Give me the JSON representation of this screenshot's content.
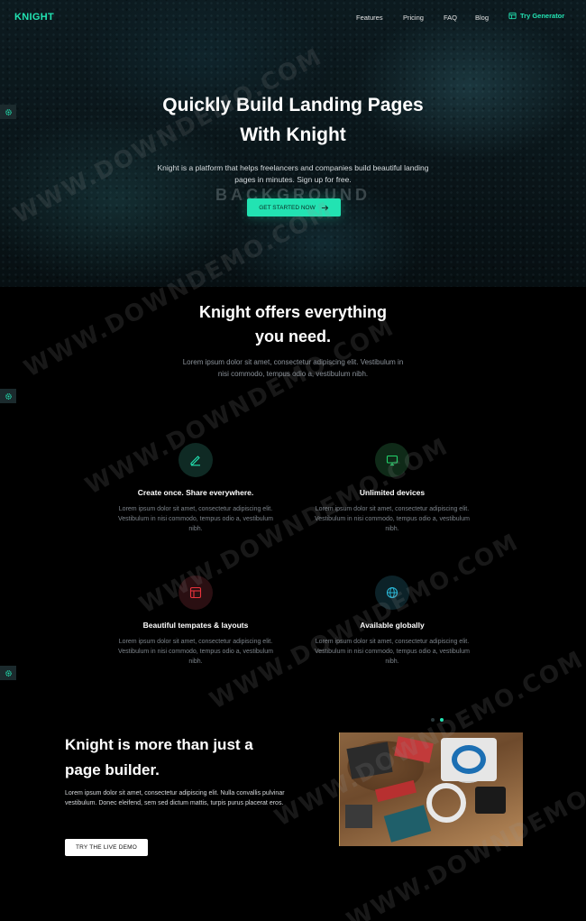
{
  "nav": {
    "logo": "KNIGHT",
    "links": [
      "Features",
      "Pricing",
      "FAQ",
      "Blog"
    ],
    "generator": "Try Generator"
  },
  "hero": {
    "title_line1": "Quickly Build Landing Pages",
    "title_line2": "With Knight",
    "subtitle": "Knight is a platform that helps freelancers and companies build beautiful landing pages in minutes. Sign up for free.",
    "bg_label": "BACKGROUND",
    "cta": "GET STARTED NOW"
  },
  "features_section": {
    "title_line1": "Knight offers everything",
    "title_line2": "you need.",
    "subtitle": "Lorem ipsum dolor sit amet, consectetur adipiscing elit. Vestibulum in nisi commodo, tempus odio a, vestibulum nibh.",
    "items": [
      {
        "icon": "pencil-icon",
        "title": "Create once. Share everywhere.",
        "text": "Lorem ipsum dolor sit amet, consectetur adipiscing elit. Vestibulum in nisi commodo, tempus odio a, vestibulum nibh.",
        "color": "#22e3b2"
      },
      {
        "icon": "monitor-icon",
        "title": "Unlimited devices",
        "text": "Lorem ipsum dolor sit amet, consectetur adipiscing elit. Vestibulum in nisi commodo, tempus odio a, vestibulum nibh.",
        "color": "#22d36a"
      },
      {
        "icon": "layout-icon",
        "title": "Beautiful tempates & layouts",
        "text": "Lorem ipsum dolor sit amet, consectetur adipiscing elit. Vestibulum in nisi commodo, tempus odio a, vestibulum nibh.",
        "color": "#e8333c"
      },
      {
        "icon": "globe-icon",
        "title": "Available globally",
        "text": "Lorem ipsum dolor sit amet, consectetur adipiscing elit. Vestibulum in nisi commodo, tempus odio a, vestibulum nibh.",
        "color": "#2ab8d8"
      }
    ]
  },
  "about": {
    "title_line1": "Knight is more than just a",
    "title_line2": "page builder.",
    "text": "Lorem ipsum dolor sit amet, consectetur adipiscing elit. Nulla convallis pulvinar vestibulum. Donec eleifend, sem sed dictum mattis, turpis purus placerat eros.",
    "cta": "TRY THE LIVE DEMO"
  },
  "watermark": "WWW.DOWNDEMO.COM",
  "colors": {
    "accent": "#22e3b2",
    "background": "#000000"
  }
}
